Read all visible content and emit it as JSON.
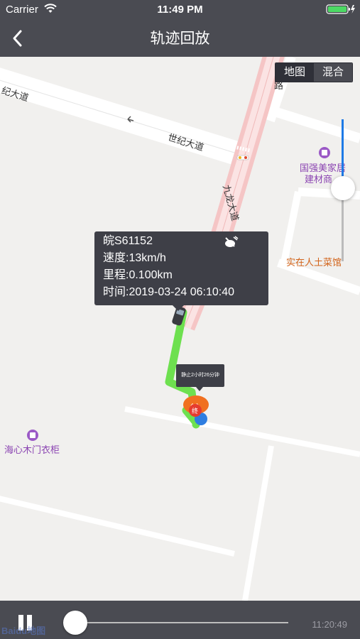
{
  "status_bar": {
    "carrier": "Carrier",
    "time": "11:49 PM"
  },
  "nav": {
    "title": "轨迹回放"
  },
  "map_type": {
    "map_label": "地图",
    "hybrid_label": "混合",
    "selected": "地图"
  },
  "zoom": {
    "level": 0.48
  },
  "labels": {
    "road_century_left": "纪大道",
    "road_century": "世纪大道",
    "road_jiulong": "九龙大道",
    "road_corner": "路",
    "poi_guoqiang_line1": "国强美家居",
    "poi_guoqiang_line2": "建材商",
    "poi_restaurant": "实在人土菜馆",
    "poi_haixin": "海心木门衣柜"
  },
  "vehicle_info": {
    "plate": "皖S61152",
    "speed": "速度:13km/h",
    "mileage": "里程:0.100km",
    "time": "时间:2019-03-24 06:10:40"
  },
  "stop_info": {
    "text": "静止2小时26分钟",
    "end_marker": "终"
  },
  "player": {
    "progress": 0.0,
    "time": "11:20:49"
  },
  "watermark": "Baidu地图",
  "colors": {
    "header": "#4a4b52",
    "track": "#6ee04f",
    "accent_blue": "#1e7ae6",
    "poi_purple": "#8b44b2",
    "poi_orange": "#d2631a"
  }
}
